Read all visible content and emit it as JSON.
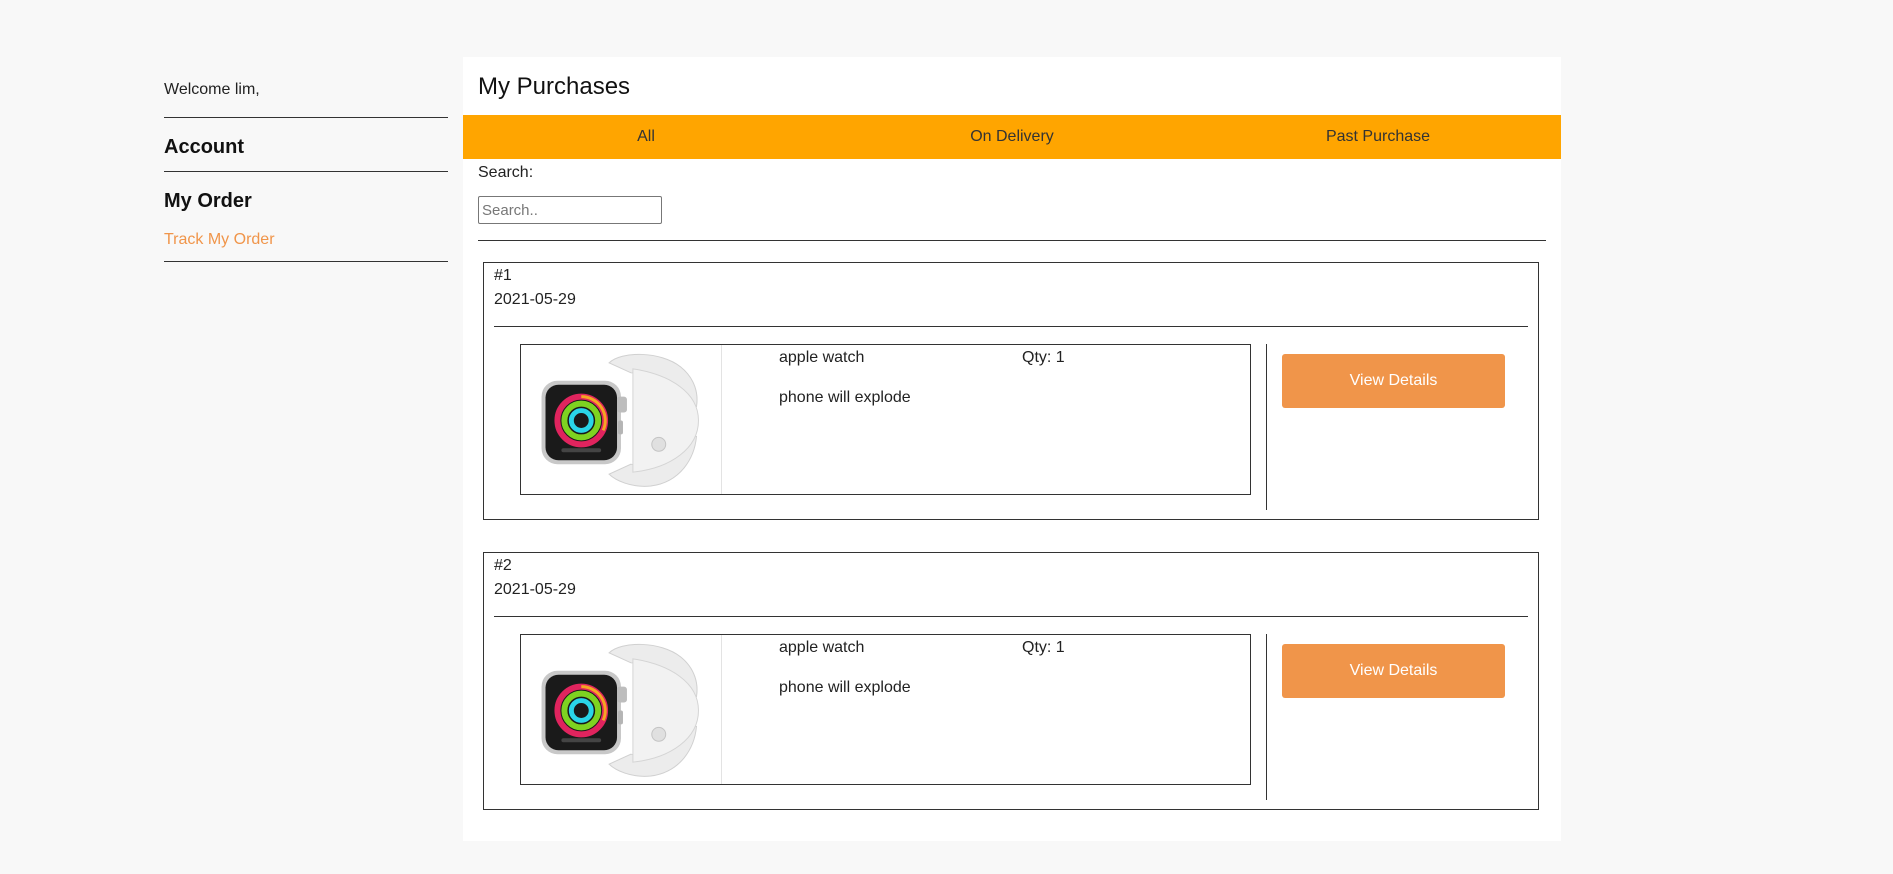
{
  "sidebar": {
    "welcome": "Welcome lim,",
    "account_heading": "Account",
    "order_heading": "My Order",
    "track_link": "Track My Order"
  },
  "main": {
    "title": "My Purchases",
    "tabs": [
      {
        "label": "All"
      },
      {
        "label": "On Delivery"
      },
      {
        "label": "Past Purchase"
      }
    ],
    "search_label": "Search:",
    "search_placeholder": "Search..",
    "view_details_label": "View Details"
  },
  "orders": [
    {
      "number": "#1",
      "date": "2021-05-29",
      "item": {
        "name": "apple watch",
        "qty": "Qty: 1",
        "description": "phone will explode",
        "image": "apple-watch-image"
      }
    },
    {
      "number": "#2",
      "date": "2021-05-29",
      "item": {
        "name": "apple watch",
        "qty": "Qty: 1",
        "description": "phone will explode",
        "image": "apple-watch-image"
      }
    }
  ],
  "colors": {
    "accent": "#ffa500",
    "button": "#f0954a",
    "link": "#f0954a",
    "page_bg": "#f8f8f8"
  }
}
